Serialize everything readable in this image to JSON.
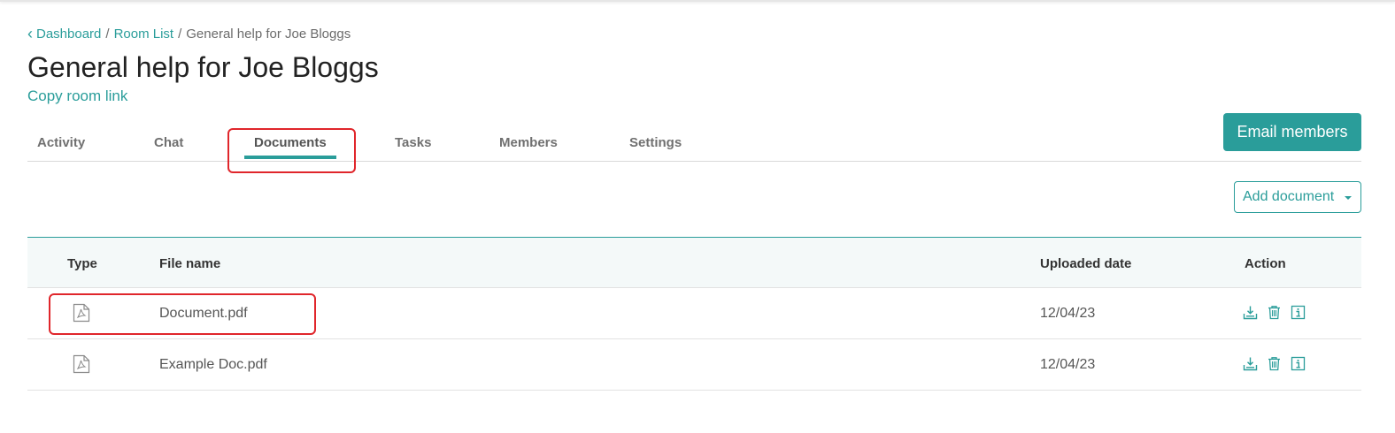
{
  "breadcrumb": {
    "dashboard": "Dashboard",
    "room_list": "Room List",
    "current": "General help for Joe Bloggs",
    "separator": "/"
  },
  "page": {
    "title": "General help for Joe Bloggs",
    "copy_link": "Copy room link",
    "email_button": "Email members"
  },
  "tabs": [
    {
      "label": "Activity"
    },
    {
      "label": "Chat"
    },
    {
      "label": "Documents",
      "active": true
    },
    {
      "label": "Tasks"
    },
    {
      "label": "Members"
    },
    {
      "label": "Settings"
    }
  ],
  "add_document": {
    "label": "Add document"
  },
  "table": {
    "headers": {
      "type": "Type",
      "file_name": "File name",
      "uploaded_date": "Uploaded date",
      "action": "Action"
    },
    "rows": [
      {
        "type_icon": "pdf-icon",
        "file_name": "Document.pdf",
        "uploaded_date": "12/04/23"
      },
      {
        "type_icon": "pdf-icon",
        "file_name": "Example Doc.pdf",
        "uploaded_date": "12/04/23"
      }
    ]
  },
  "colors": {
    "accent": "#2a9d9a",
    "highlight": "#e0262b",
    "header_bg": "#f4f9f9"
  }
}
